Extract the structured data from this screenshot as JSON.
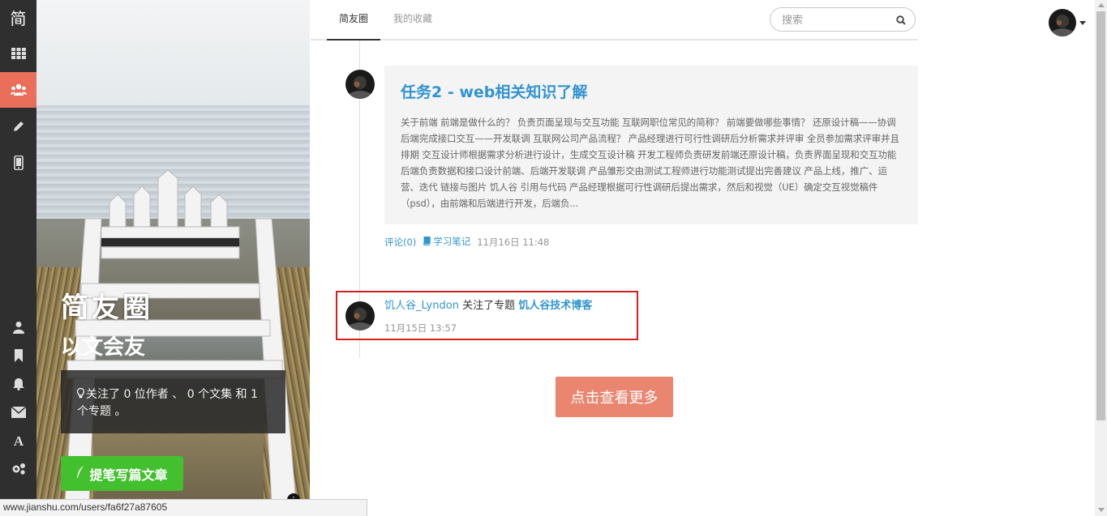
{
  "brand": {
    "logo_text": "简"
  },
  "rail": {
    "items": [
      {
        "icon": "grid-icon"
      },
      {
        "icon": "users-icon",
        "active": true
      },
      {
        "icon": "pencil-icon"
      },
      {
        "icon": "phone-icon"
      },
      {
        "icon": "user-icon"
      },
      {
        "icon": "bookmark-icon"
      },
      {
        "icon": "bell-icon"
      },
      {
        "icon": "mail-icon"
      },
      {
        "icon": "font-icon"
      },
      {
        "icon": "gear-icon"
      }
    ],
    "active_color": "#ea6f5a"
  },
  "hero": {
    "title": "简友圈",
    "subtitle": "以文会友",
    "info": "关注了 0 位作者 、 0 个文集 和 1 个专题 。",
    "write_button": "提笔写篇文章"
  },
  "nav": {
    "tabs": [
      {
        "label": "简友圈",
        "active": true
      },
      {
        "label": "我的收藏",
        "active": false
      }
    ],
    "search_placeholder": "搜索"
  },
  "feed": {
    "post": {
      "title": "任务2 - web相关知识了解",
      "excerpt": "关于前端 前端是做什么的？ 负责页面呈现与交互功能 互联网职位常见的简称？ 前端要做哪些事情？ 还原设计稿——协调后端完成接口交互——开发联调 互联网公司产品流程？ 产品经理进行可行性调研后分析需求并评审 全员参加需求评审并且排期 交互设计师根据需求分析进行设计，生成交互设计稿 开发工程师负责研发前端还原设计稿，负责界面呈现和交互功能后端负责数据和接口设计前端、后端开发联调 产品雏形交由测试工程师进行功能测试提出完善建议 产品上线，推广、运营、迭代 链接与图片 饥人谷 引用与代码 产品经理根据可行性调研后提出需求，然后和视觉（UE）确定交互视觉稿件（psd），由前端和后端进行开发，后端负...",
      "comments": "评论(0)",
      "notebook": "学习笔记",
      "time": "11月16日 11:48"
    },
    "activity": {
      "user": "饥人谷_Lyndon",
      "action": "关注了专题",
      "topic": "饥人谷技术博客",
      "time": "11月15日 13:57",
      "highlight_color": "#d71e1e"
    },
    "load_more": "点击查看更多"
  },
  "status_url": "www.jianshu.com/users/fa6f27a87605",
  "colors": {
    "link": "#3194d0",
    "write_button": "#42c02e",
    "load_more": "#ea8670"
  }
}
